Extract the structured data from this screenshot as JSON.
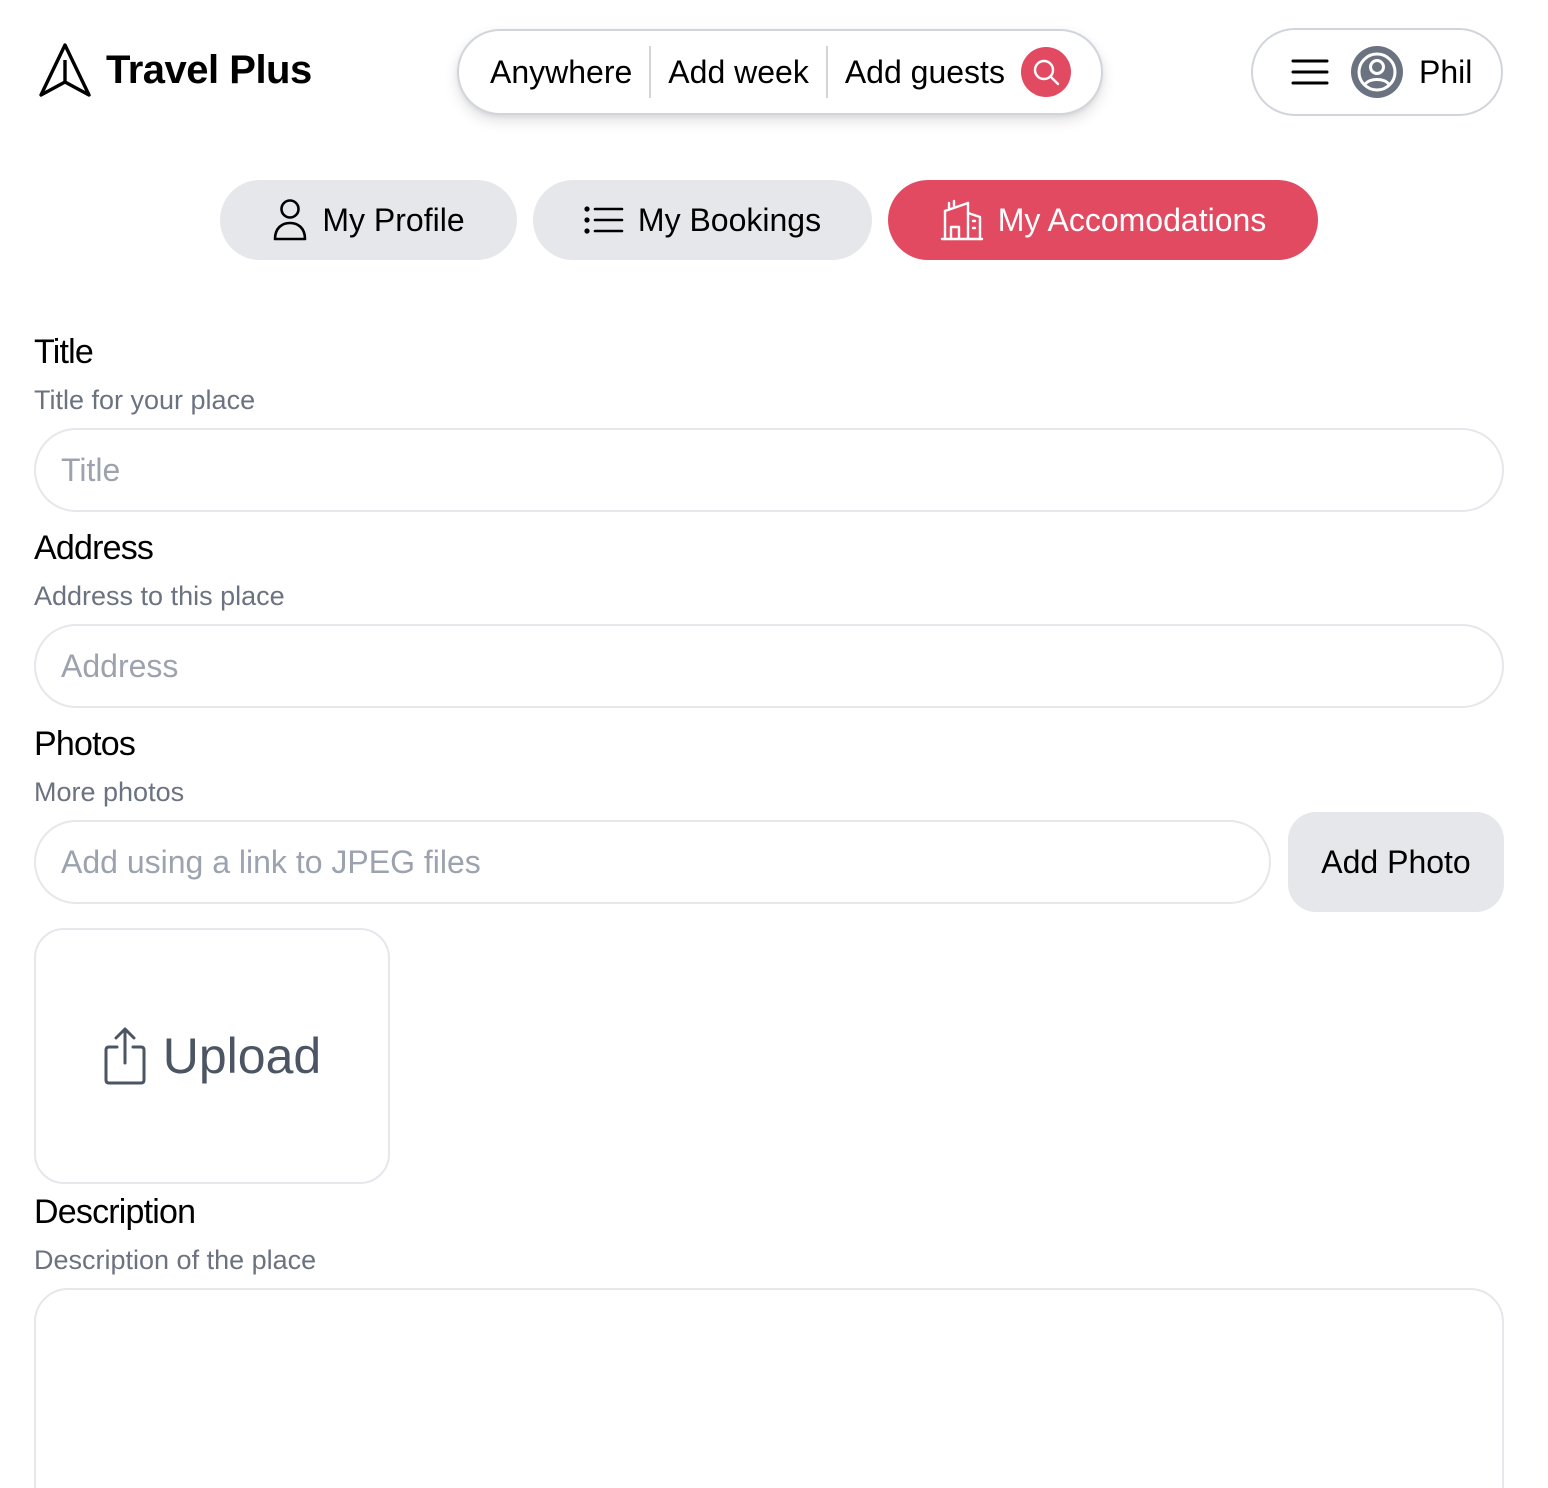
{
  "header": {
    "app_name": "Travel Plus",
    "logo_icon": "paper-plane-icon",
    "search": {
      "location": "Anywhere",
      "week": "Add week",
      "guests": "Add guests",
      "search_icon": "search-icon"
    },
    "user": {
      "menu_icon": "hamburger-icon",
      "avatar_icon": "user-circle-icon",
      "name": "Phil"
    }
  },
  "tabs": [
    {
      "label": "My Profile",
      "icon": "user-icon",
      "active": false
    },
    {
      "label": "My Bookings",
      "icon": "list-icon",
      "active": false
    },
    {
      "label": "My Accomodations",
      "icon": "building-icon",
      "active": true
    }
  ],
  "form": {
    "title": {
      "label": "Title",
      "hint": "Title for your place",
      "placeholder": "Title",
      "value": ""
    },
    "address": {
      "label": "Address",
      "hint": "Address to this place",
      "placeholder": "Address",
      "value": ""
    },
    "photos": {
      "label": "Photos",
      "hint": "More photos",
      "placeholder": "Add using a link to JPEG files",
      "add_button": "Add Photo",
      "upload_label": "Upload",
      "upload_icon": "upload-icon"
    },
    "description": {
      "label": "Description",
      "hint": "Description of the place",
      "value": ""
    }
  },
  "colors": {
    "accent": "#e24a62",
    "tab_inactive_bg": "#e5e7eb",
    "hint_text": "#6b7280",
    "border": "#e5e7eb"
  }
}
